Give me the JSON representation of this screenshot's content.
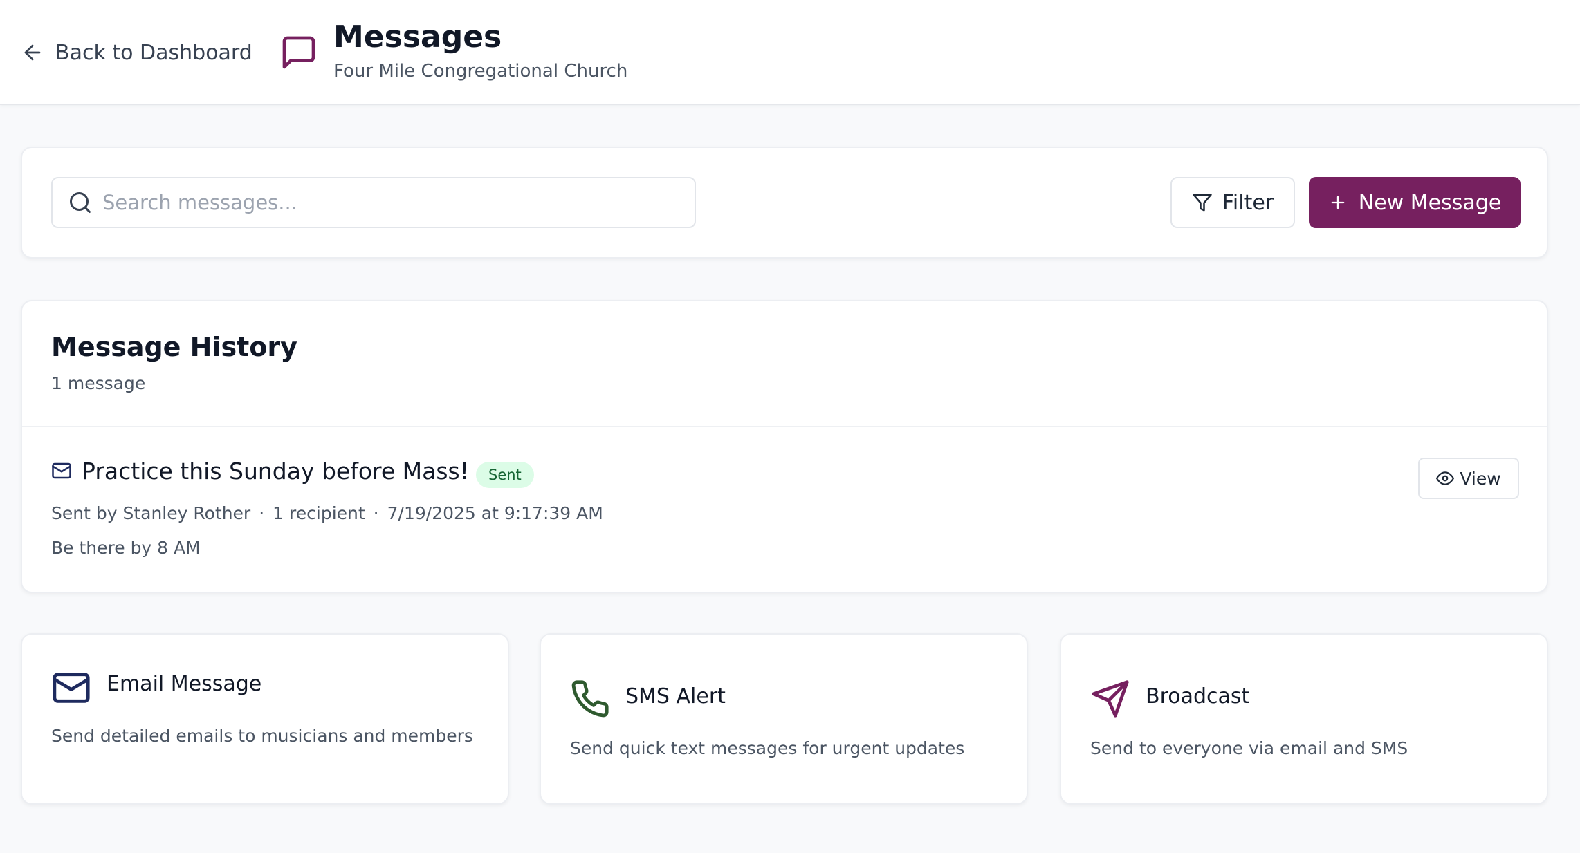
{
  "header": {
    "back_label": "Back to Dashboard",
    "title": "Messages",
    "subtitle": "Four Mile Congregational Church",
    "icon": "message-square-icon"
  },
  "toolbar": {
    "search_placeholder": "Search messages...",
    "filter_label": "Filter",
    "new_message_label": "New Message"
  },
  "history": {
    "title": "Message History",
    "count_text": "1 message",
    "messages": [
      {
        "subject": "Practice this Sunday before Mass!",
        "status": "Sent",
        "sender": "Sent by Stanley Rother",
        "recipients": "1 recipient",
        "timestamp": "7/19/2025 at 9:17:39 AM",
        "preview": "Be there by 8 AM",
        "view_label": "View"
      }
    ]
  },
  "message_types": [
    {
      "title": "Email Message",
      "description": "Send detailed emails to musicians and members",
      "icon": "mail-icon"
    },
    {
      "title": "SMS Alert",
      "description": "Send quick text messages for urgent updates",
      "icon": "phone-icon"
    },
    {
      "title": "Broadcast",
      "description": "Send to everyone via email and SMS",
      "icon": "send-icon"
    }
  ],
  "colors": {
    "brand": "#76205f",
    "badge_bg": "#dcfce7",
    "badge_text": "#166534",
    "email_icon": "#1e2a5e",
    "sms_icon": "#2f5a2f",
    "broadcast_icon": "#76205f"
  }
}
